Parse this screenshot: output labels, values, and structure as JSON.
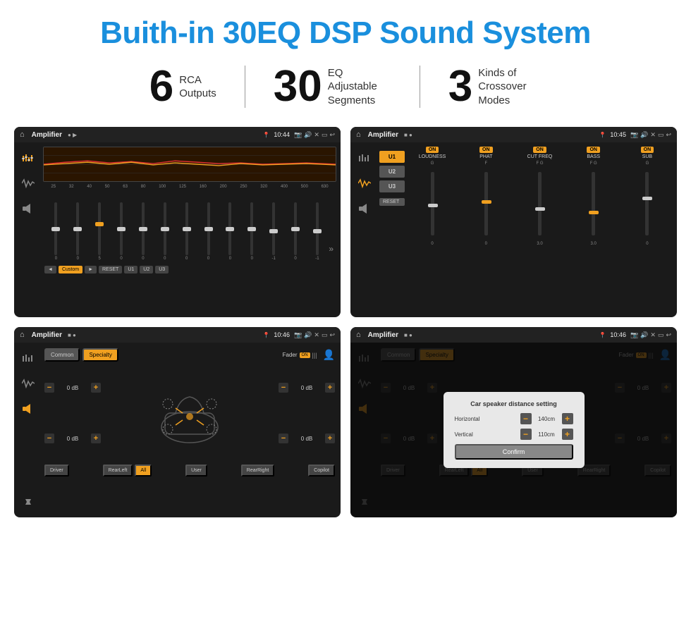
{
  "header": {
    "title": "Buith-in 30EQ DSP Sound System"
  },
  "stats": [
    {
      "number": "6",
      "label": "RCA\nOutputs"
    },
    {
      "number": "30",
      "label": "EQ Adjustable\nSegments"
    },
    {
      "number": "3",
      "label": "Kinds of\nCrossover Modes"
    }
  ],
  "screens": [
    {
      "id": "screen1",
      "topbar": {
        "title": "Amplifier",
        "time": "10:44"
      },
      "type": "eq",
      "freq_labels": [
        "25",
        "32",
        "40",
        "50",
        "63",
        "80",
        "100",
        "125",
        "160",
        "200",
        "250",
        "320",
        "400",
        "500",
        "630"
      ],
      "slider_values": [
        "0",
        "0",
        "0",
        "5",
        "0",
        "0",
        "0",
        "0",
        "0",
        "0",
        "0",
        "-1",
        "0",
        "-1"
      ],
      "bottom_btns": [
        "◄",
        "Custom",
        "►",
        "RESET",
        "U1",
        "U2",
        "U3"
      ]
    },
    {
      "id": "screen2",
      "topbar": {
        "title": "Amplifier",
        "time": "10:45"
      },
      "type": "crossover",
      "units": [
        "U1",
        "U2",
        "U3"
      ],
      "cols": [
        "LOUDNESS",
        "PHAT",
        "CUT FREQ",
        "BASS",
        "SUB"
      ],
      "reset_label": "RESET"
    },
    {
      "id": "screen3",
      "topbar": {
        "title": "Amplifier",
        "time": "10:46"
      },
      "type": "fader",
      "mode_btns": [
        "Common",
        "Specialty"
      ],
      "fader_label": "Fader",
      "db_values": [
        "0 dB",
        "0 dB",
        "0 dB",
        "0 dB"
      ],
      "location_btns": [
        "Driver",
        "RearLeft",
        "All",
        "User",
        "RearRight",
        "Copilot"
      ]
    },
    {
      "id": "screen4",
      "topbar": {
        "title": "Amplifier",
        "time": "10:46"
      },
      "type": "fader-dialog",
      "mode_btns": [
        "Common",
        "Specialty"
      ],
      "dialog": {
        "title": "Car speaker distance setting",
        "horizontal_label": "Horizontal",
        "horizontal_value": "140cm",
        "vertical_label": "Vertical",
        "vertical_value": "110cm",
        "confirm_label": "Confirm"
      },
      "db_values": [
        "0 dB",
        "0 dB"
      ],
      "location_btns": [
        "Driver",
        "RearLeft",
        "All",
        "User",
        "RearRight",
        "Copilot"
      ]
    }
  ]
}
